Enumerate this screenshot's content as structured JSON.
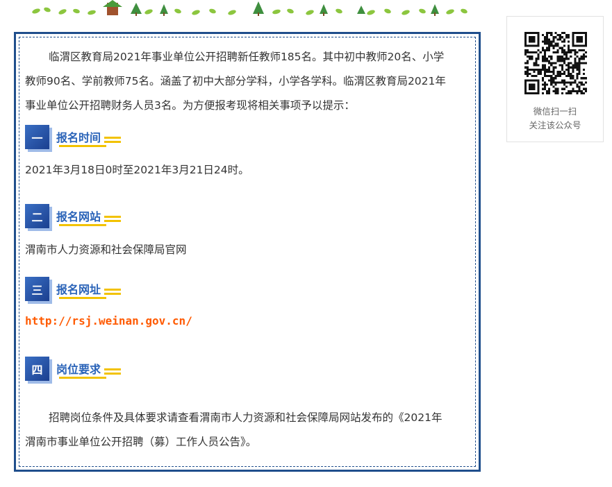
{
  "intro": {
    "line1": "临渭区教育局2021年事业单位公开招聘新任教师185名。其中初中教师20名、小学",
    "line2": "教师90名、学前教师75名。涵盖了初中大部分学科，小学各学科。临渭区教育局2021年",
    "line3": "事业单位公开招聘财务人员3名。为方便报考现将相关事项予以提示："
  },
  "sections": [
    {
      "number": "一",
      "title": "报名时间",
      "content": "2021年3月18日0时至2021年3月21日24时。"
    },
    {
      "number": "二",
      "title": "报名网站",
      "content": "渭南市人力资源和社会保障局官网"
    },
    {
      "number": "三",
      "title": "报名网址",
      "content": "http://rsj.weinan.gov.cn/"
    },
    {
      "number": "四",
      "title": "岗位要求",
      "content_line1": "招聘岗位条件及具体要求请查看渭南市人力资源和社会保障局网站发布的《2021年",
      "content_line2": "渭南市事业单位公开招聘（募）工作人员公告》。"
    }
  ],
  "sidebar": {
    "qr_caption_1": "微信扫一扫",
    "qr_caption_2": "关注该公众号"
  },
  "colors": {
    "frame": "#1f4e8c",
    "section_title": "#2a63b8",
    "highlight_yellow": "#f2c200",
    "link": "#ff5a00"
  }
}
